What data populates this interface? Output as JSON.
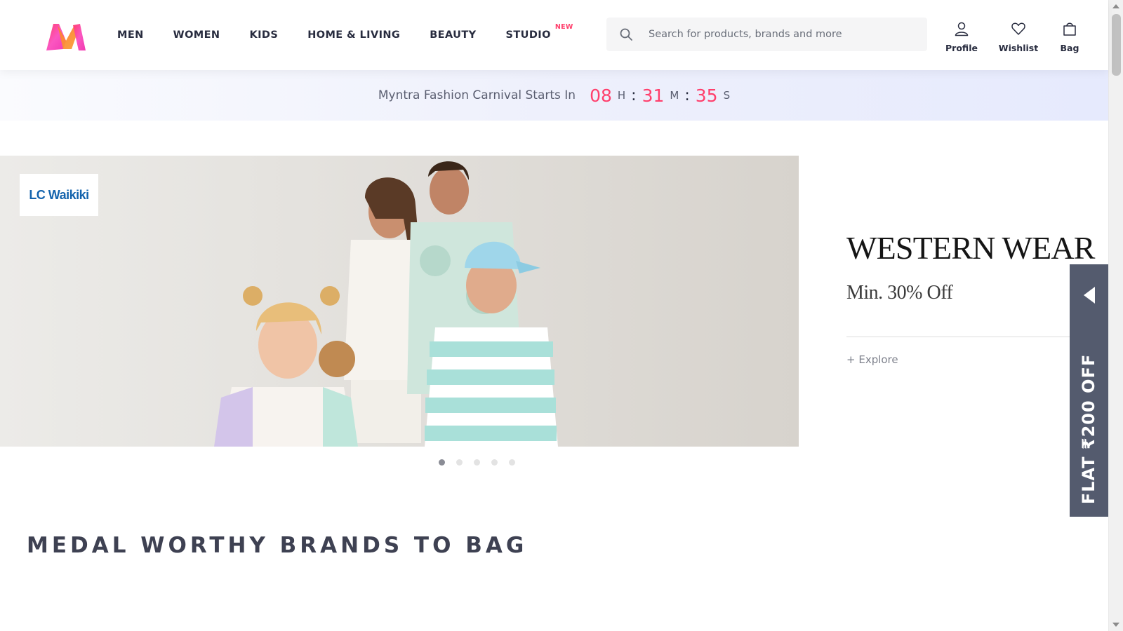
{
  "header": {
    "logo_name": "myntra-logo",
    "nav": [
      {
        "label": "MEN"
      },
      {
        "label": "WOMEN"
      },
      {
        "label": "KIDS"
      },
      {
        "label": "HOME & LIVING"
      },
      {
        "label": "BEAUTY"
      },
      {
        "label": "STUDIO",
        "tag": "NEW"
      }
    ],
    "search": {
      "placeholder": "Search for products, brands and more",
      "icon": "search-icon"
    },
    "actions": [
      {
        "label": "Profile",
        "icon": "user-icon"
      },
      {
        "label": "Wishlist",
        "icon": "heart-icon"
      },
      {
        "label": "Bag",
        "icon": "bag-icon"
      }
    ]
  },
  "countdown": {
    "text": "Myntra Fashion Carnival Starts In",
    "hours": "08",
    "hours_unit": "H",
    "minutes": "31",
    "minutes_unit": "M",
    "seconds": "35",
    "seconds_unit": "S"
  },
  "hero": {
    "brand_badge": "LC Waikiki",
    "title": "WESTERN WEAR",
    "subtitle": "Min. 30% Off",
    "cta": "+ Explore",
    "slide_count": 5,
    "active_slide": 1
  },
  "flat_offer": {
    "text": "FLAT ₹200 OFF"
  },
  "section": {
    "title": "MEDAL WORTHY BRANDS TO BAG"
  },
  "colors": {
    "accent": "#ff3f6c",
    "text": "#282c3f",
    "tab_bg": "#545b6e"
  }
}
